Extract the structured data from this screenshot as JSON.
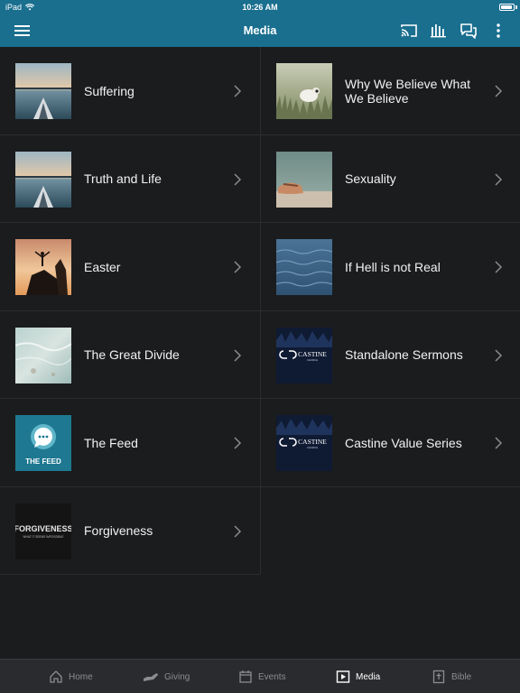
{
  "status": {
    "carrier": "iPad",
    "time": "10:26 AM"
  },
  "header": {
    "title": "Media"
  },
  "colors": {
    "header_bg": "#1a6f8f",
    "background": "#1b1c1e",
    "tabbar_bg": "#2a2b2e",
    "active_tab": "#ffffff",
    "inactive_tab": "#8c8d90"
  },
  "media": {
    "left": [
      {
        "label": "Suffering",
        "thumb": "kayak-sunset"
      },
      {
        "label": "Truth and Life",
        "thumb": "kayak-sunset"
      },
      {
        "label": "Easter",
        "thumb": "person-on-rock-sunset"
      },
      {
        "label": "The Great Divide",
        "thumb": "shallow-water"
      },
      {
        "label": "The Feed",
        "thumb": "the-feed-logo",
        "thumb_text": "THE FEED"
      },
      {
        "label": "Forgiveness",
        "thumb": "forgiveness-title",
        "thumb_text": "FORGIVENESS",
        "thumb_subtext": "WHAT IT SEEMS IMPOSSIBLE"
      }
    ],
    "right": [
      {
        "label": "Why We Believe What We Believe",
        "thumb": "sheep-in-grass"
      },
      {
        "label": "Sexuality",
        "thumb": "hands-by-water"
      },
      {
        "label": "If Hell is not Real",
        "thumb": "ocean-water"
      },
      {
        "label": "Standalone Sermons",
        "thumb": "castine-church-logo",
        "thumb_text": "CASTINE",
        "thumb_subtext": "CHURCH"
      },
      {
        "label": "Castine Value Series",
        "thumb": "castine-church-logo",
        "thumb_text": "CASTINE",
        "thumb_subtext": "CHURCH"
      }
    ]
  },
  "tabs": [
    {
      "label": "Home",
      "icon": "home-icon",
      "active": false
    },
    {
      "label": "Giving",
      "icon": "giving-hand-icon",
      "active": false
    },
    {
      "label": "Events",
      "icon": "calendar-icon",
      "active": false
    },
    {
      "label": "Media",
      "icon": "play-icon",
      "active": true
    },
    {
      "label": "Bible",
      "icon": "bible-icon",
      "active": false
    }
  ]
}
